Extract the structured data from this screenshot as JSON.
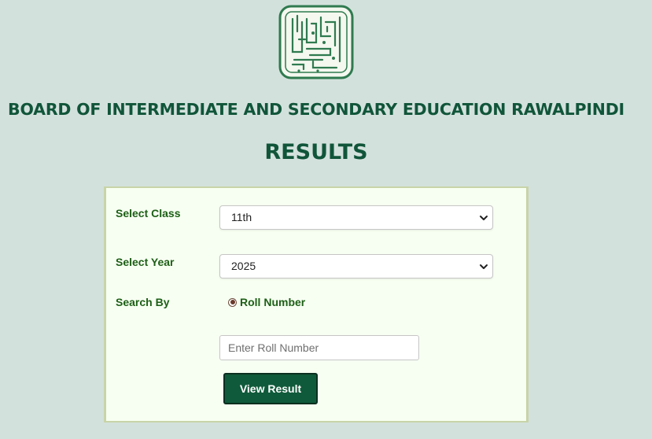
{
  "header": {
    "board_title": "BOARD OF INTERMEDIATE AND SECONDARY EDUCATION RAWALPINDI",
    "results_title": "RESULTS"
  },
  "logo": {
    "icon": "calligraphy-seal-logo",
    "colors": {
      "primary": "#2f7a4f",
      "background": "#f4f8ef"
    }
  },
  "form": {
    "class_label": "Select Class",
    "class_selected": "11th",
    "year_label": "Select Year",
    "year_selected": "2025",
    "search_by_label": "Search By",
    "search_option": "Roll Number",
    "roll_placeholder": "Enter Roll Number",
    "roll_value": "",
    "submit_label": "View Result"
  },
  "colors": {
    "page_bg": "#d3e1dc",
    "heading": "#10553a",
    "label": "#1d5f16",
    "panel_bg": "#f7fff2",
    "button_bg": "#0f5a3a"
  }
}
